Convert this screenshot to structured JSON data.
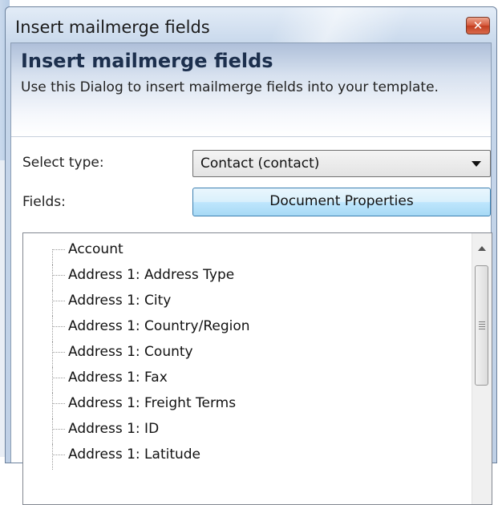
{
  "window": {
    "title": "Insert mailmerge fields",
    "close_icon": "close-icon"
  },
  "header": {
    "title": "Insert mailmerge fields",
    "description": "Use this Dialog to insert mailmerge fields into your template."
  },
  "form": {
    "select_type_label": "Select type:",
    "select_type_value": "Contact (contact)",
    "fields_label": "Fields:",
    "document_properties_button": "Document Properties"
  },
  "fields_tree": {
    "items": [
      "Account",
      "Address 1: Address Type",
      "Address 1: City",
      "Address 1: Country/Region",
      "Address 1: County",
      "Address 1: Fax",
      "Address 1: Freight Terms",
      "Address 1: ID",
      "Address 1: Latitude"
    ]
  },
  "colors": {
    "header_title": "#1c2f4d",
    "button_border": "#3c7fb1",
    "close_button": "#d4573a"
  }
}
